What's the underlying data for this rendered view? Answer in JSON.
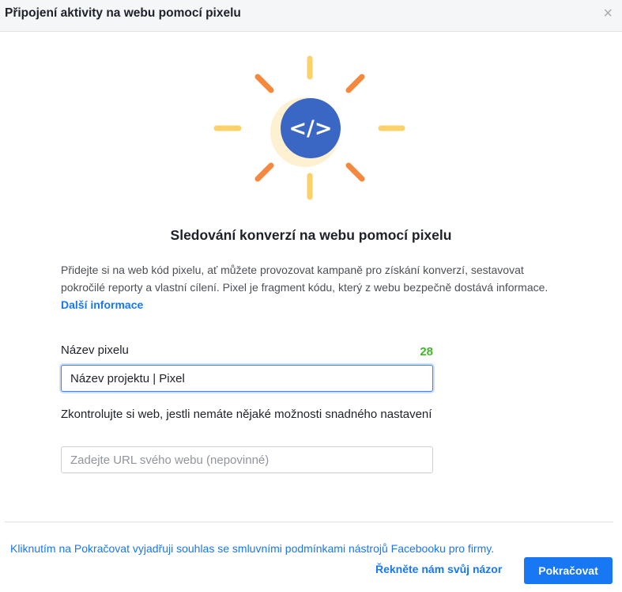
{
  "dialog": {
    "title": "Připojení aktivity na webu pomocí pixelu",
    "close_icon": "close-icon"
  },
  "hero": {
    "icon": "code-icon",
    "symbol": "</>",
    "colors": {
      "circle": "#3b67c4",
      "orange": "#f4893e",
      "yellow": "#fbd26a"
    }
  },
  "content": {
    "headline": "Sledování konverzí na webu pomocí pixelu",
    "description": "Přidejte si na web kód pixelu, ať můžete provozovat kampaně pro získání konverzí, sestavovat pokročilé reporty a vlastní cílení. Pixel je fragment kódu, který z webu bezpečně dostává informace.",
    "learn_more_link": "Další informace"
  },
  "form": {
    "pixel_name_label": "Název pixelu",
    "pixel_name_counter": "28",
    "pixel_name_value": "Název projektu | Pixel",
    "website_label": "Zkontrolujte si web, jestli nemáte nějaké možnosti snadného nastavení",
    "website_placeholder": "Zadejte URL svého webu (nepovinné)"
  },
  "footer": {
    "terms_text": "Kliknutím na Pokračovat vyjadřuji souhlas se smluvními podmínkami nástrojů Facebooku pro firmy.",
    "feedback_link": "Řekněte nám svůj názor",
    "continue_button": "Pokračovat"
  }
}
